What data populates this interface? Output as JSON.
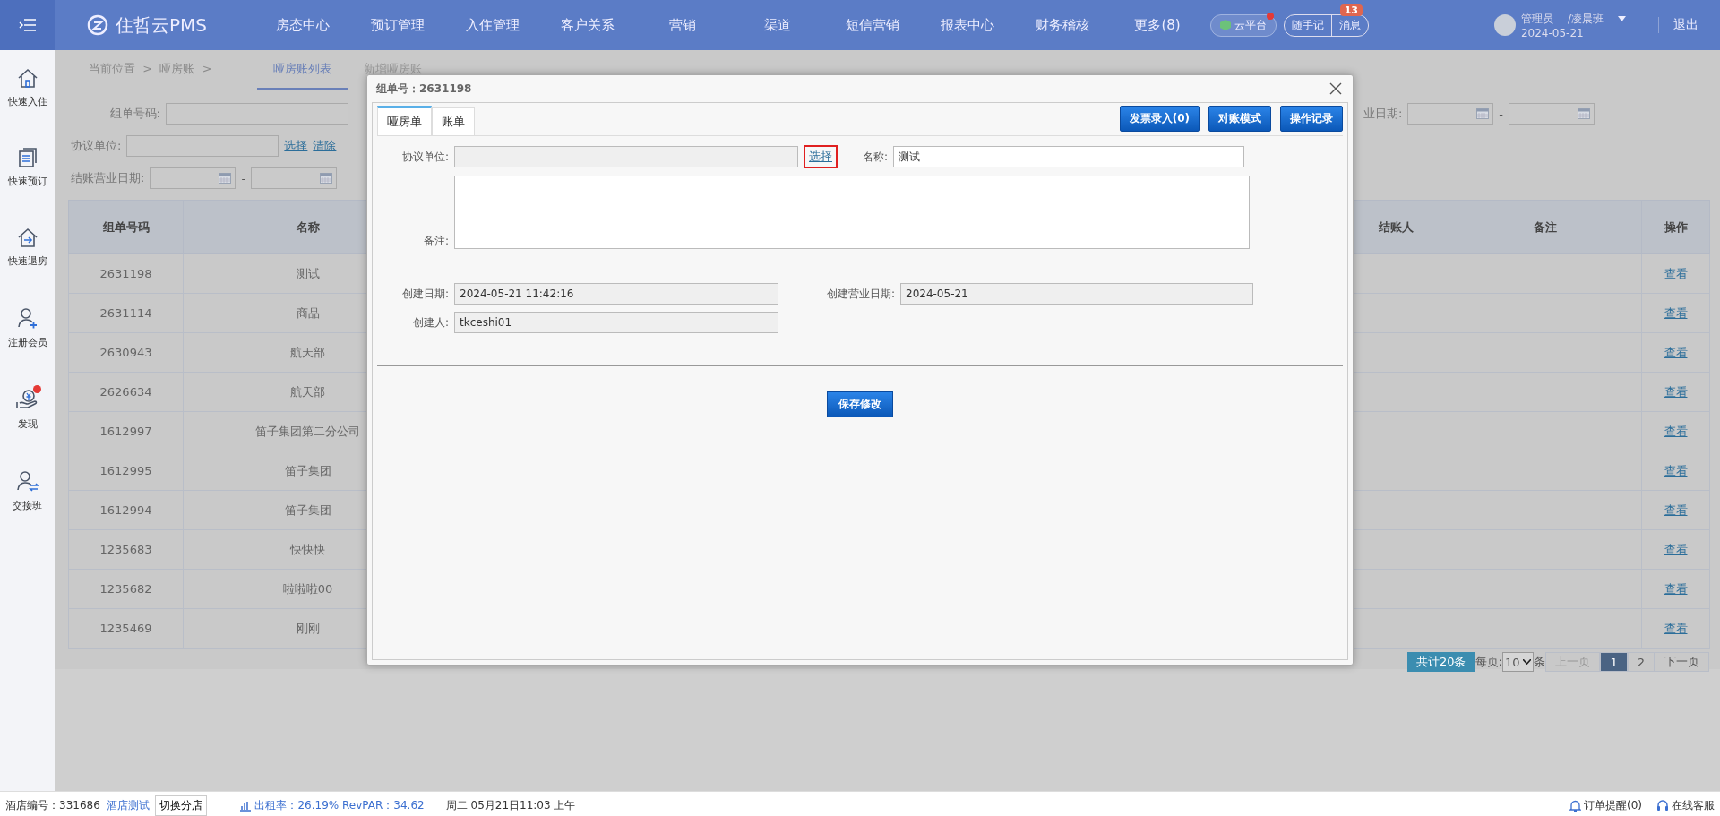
{
  "topbar": {
    "brand": "住哲云PMS",
    "nav": [
      "房态中心",
      "预订管理",
      "入住管理",
      "客户关系",
      "营销",
      "渠道",
      "短信营销",
      "报表中心",
      "财务稽核",
      "更多(8)"
    ],
    "cloud": {
      "label": "云平台",
      "alert": true
    },
    "notes": "随手记",
    "messages": {
      "label": "消息",
      "badge": "13"
    },
    "user": {
      "role": "管理员",
      "shift": "/凌晨班",
      "date": "2024-05-21"
    },
    "logout": "退出"
  },
  "sidebar": [
    {
      "kind": "checkin",
      "label": "快速入住",
      "alert": false
    },
    {
      "kind": "booking",
      "label": "快速预订",
      "alert": false
    },
    {
      "kind": "checkout",
      "label": "快速退房",
      "alert": false
    },
    {
      "kind": "member",
      "label": "注册会员",
      "alert": false
    },
    {
      "kind": "discover",
      "label": "发现",
      "alert": true
    },
    {
      "kind": "shift",
      "label": "交接班",
      "alert": false
    }
  ],
  "breadcrumb": "当前位置  >  哑房账  >",
  "tabs": [
    {
      "label": "哑房账列表",
      "selected": true
    },
    {
      "label": "新增哑房账",
      "selected": false
    }
  ],
  "filters": {
    "group_no": "组单号码:",
    "unit": "协议单位:",
    "unit_select": "选择",
    "unit_clear": "清除",
    "checkout_date": "结账营业日期:",
    "date_sep": "-",
    "right_date": "业日期:",
    "right_sep": "-"
  },
  "table": {
    "columns": [
      "组单号码",
      "名称",
      "结账人",
      "备注",
      "操作"
    ],
    "rows": [
      {
        "id": "2631198",
        "name": "测试",
        "action": "查看"
      },
      {
        "id": "2631114",
        "name": "商品",
        "action": "查看"
      },
      {
        "id": "2630943",
        "name": "航天部",
        "action": "查看"
      },
      {
        "id": "2626634",
        "name": "航天部",
        "action": "查看"
      },
      {
        "id": "1612997",
        "name": "笛子集团第二分公司",
        "action": "查看"
      },
      {
        "id": "1612995",
        "name": "笛子集团",
        "action": "查看"
      },
      {
        "id": "1612994",
        "name": "笛子集团",
        "action": "查看"
      },
      {
        "id": "1235683",
        "name": "快快快",
        "action": "查看"
      },
      {
        "id": "1235682",
        "name": "啦啦啦00",
        "action": "查看"
      },
      {
        "id": "1235469",
        "name": "刚刚",
        "action": "查看"
      }
    ]
  },
  "pagination": {
    "total": "共计20条",
    "per_page_label": "每页:",
    "per_page": "10",
    "unit": "条",
    "prev": "上一页",
    "prev_disabled": true,
    "pages": [
      {
        "label": "1",
        "selected": true
      },
      {
        "label": "2",
        "selected": false
      }
    ],
    "next": "下一页"
  },
  "modal": {
    "title": "组单号：2631198",
    "tabs": [
      {
        "label": "哑房单",
        "selected": true
      },
      {
        "label": "账单",
        "selected": false
      }
    ],
    "buttons": [
      "发票录入(0)",
      "对账模式",
      "操作记录"
    ],
    "unit_label": "协议单位:",
    "select_link": {
      "label": "选择",
      "highlighted": true
    },
    "name_label": "名称:",
    "name_value": "测试",
    "remark_label": "备注:",
    "created_label": "创建日期:",
    "created_value": "2024-05-21 11:42:16",
    "biz_label": "创建营业日期:",
    "biz_value": "2024-05-21",
    "creator_label": "创建人:",
    "creator_value": "tkceshi01",
    "save": "保存修改"
  },
  "status_bar": {
    "hotel_no": "酒店编号：331686",
    "hotel_name": "酒店测试",
    "switch": "切换分店",
    "stats": "出租率：26.19% RevPAR：34.62",
    "datetime": "周二 05月21日11:03 上午",
    "order_alert": "订单提醒(0)",
    "support": "在线客服"
  }
}
